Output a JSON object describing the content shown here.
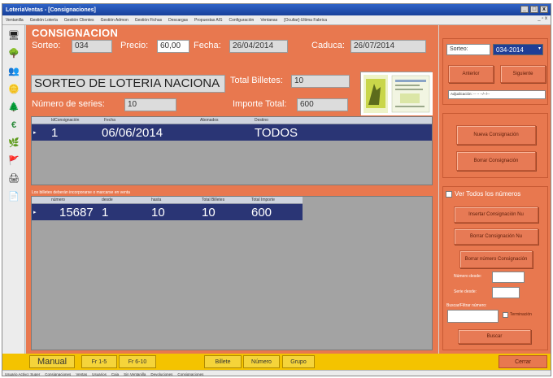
{
  "window": {
    "title": "LoteriaVentas - [Consignaciones]",
    "controls": [
      "_",
      "□",
      "x"
    ]
  },
  "menu": {
    "items": [
      "Ventanilla",
      "Gestión Lotería",
      "Gestión Clientes",
      "Gestión Admon",
      "Gestión Fichas",
      "Descargas",
      "Propuestas AIS",
      "Configuración",
      "Ventanas",
      "[Ocultar]-Ultima Fabrica"
    ],
    "mdi_controls": "_ ▫ x"
  },
  "toolbar": {
    "icons": [
      {
        "name": "monitor-icon",
        "glyph": "🖥",
        "color": "#4a7ab8"
      },
      {
        "name": "tree-icon",
        "glyph": "🌳",
        "color": "#3a8a3a"
      },
      {
        "name": "people-icon",
        "glyph": "👥",
        "color": "#3a6ab8"
      },
      {
        "name": "coins-icon",
        "glyph": "🪙",
        "color": "#d4a017"
      },
      {
        "name": "tree-icon-2",
        "glyph": "🌲",
        "color": "#8a5a2a"
      },
      {
        "name": "euro-icon",
        "glyph": "€",
        "color": "#2a8a3a"
      },
      {
        "name": "plant-icon",
        "glyph": "🌿",
        "color": "#3a8a3a"
      },
      {
        "name": "flag-icon",
        "glyph": "🚩",
        "color": "#c83a2a"
      },
      {
        "name": "printer-icon",
        "glyph": "🖨",
        "color": "#555555"
      },
      {
        "name": "document-icon",
        "glyph": "📄",
        "color": "#777777"
      }
    ]
  },
  "consignacion": {
    "heading": "CONSIGNACION",
    "sorteo_label": "Sorteo:",
    "sorteo_value": "034",
    "precio_label": "Precio:",
    "precio_value": "60,00",
    "fecha_label": "Fecha:",
    "fecha_value": "26/04/2014",
    "caduca_label": "Caduca:",
    "caduca_value": "26/07/2014",
    "sorteo_name": "SORTEO DE LOTERIA NACIONA",
    "total_billetes_label": "Total Billetes:",
    "total_billetes_value": "10",
    "numero_series_label": "Número de series:",
    "numero_series_value": "10",
    "importe_total_label": "Importe Total:",
    "importe_total_value": "600"
  },
  "grid_top": {
    "headers": [
      "IdConsignación",
      "Fecha",
      "Abonados",
      "Destino"
    ],
    "row": {
      "id": "1",
      "fecha": "06/06/2014",
      "abonados": "",
      "destino": "TODOS"
    }
  },
  "grid_note": "Los billetes deberán incorporarse o marcarse en venta",
  "grid_bottom": {
    "headers": [
      "número",
      "desde",
      "hasta",
      "Total Billetes",
      "Total Importe"
    ],
    "row": {
      "numero": "15687",
      "desde": "1",
      "hasta": "10",
      "total_billetes": "10",
      "total_importe": "600"
    }
  },
  "right_panel": {
    "sorteo_label": "Sorteo:",
    "sorteo_select": "034-2014",
    "anterior_button": "Anterior",
    "siguiente_button": "Siguiente",
    "date_select": "Adjudicación: -- -- --/--/--",
    "nueva_consignacion": "Nueva Consignación",
    "borrar_consignacion": "Borrar Consignación",
    "ver_todos_label": "Ver Todos los números",
    "insertar_consignacion_nu": "Insertar Consignación Nu",
    "borrar_consignacion_nu": "Borrar Consignación Nu",
    "borrar_numero": "Borrar número Consignación",
    "numero_desde_label": "Número desde:",
    "serie_desde_label": "Serie desde:",
    "buscar_label": "Buscar/Filtrar número:",
    "terminacion_label": "Terminación",
    "buscar_button": "Buscar"
  },
  "bottom_tabs": {
    "manual": "Manual",
    "fr15": "Fr 1-5",
    "fr610": "Fr 6-10",
    "billete": "Billete",
    "numero": "Número",
    "grupo": "Grupo",
    "cerrar": "Cerrar"
  },
  "statusbar": [
    "Usuario Activo: Super",
    "Consignaciones",
    "Ventas",
    "Usuarios",
    "Caja",
    "Sin Ventanilla",
    "Devoluciones",
    "Consignaciones"
  ],
  "colors": {
    "panel": "#e8784f",
    "grid_selected": "#2a3575",
    "bottom_bar": "#f4c300",
    "title_bar": "#2f63c8"
  }
}
